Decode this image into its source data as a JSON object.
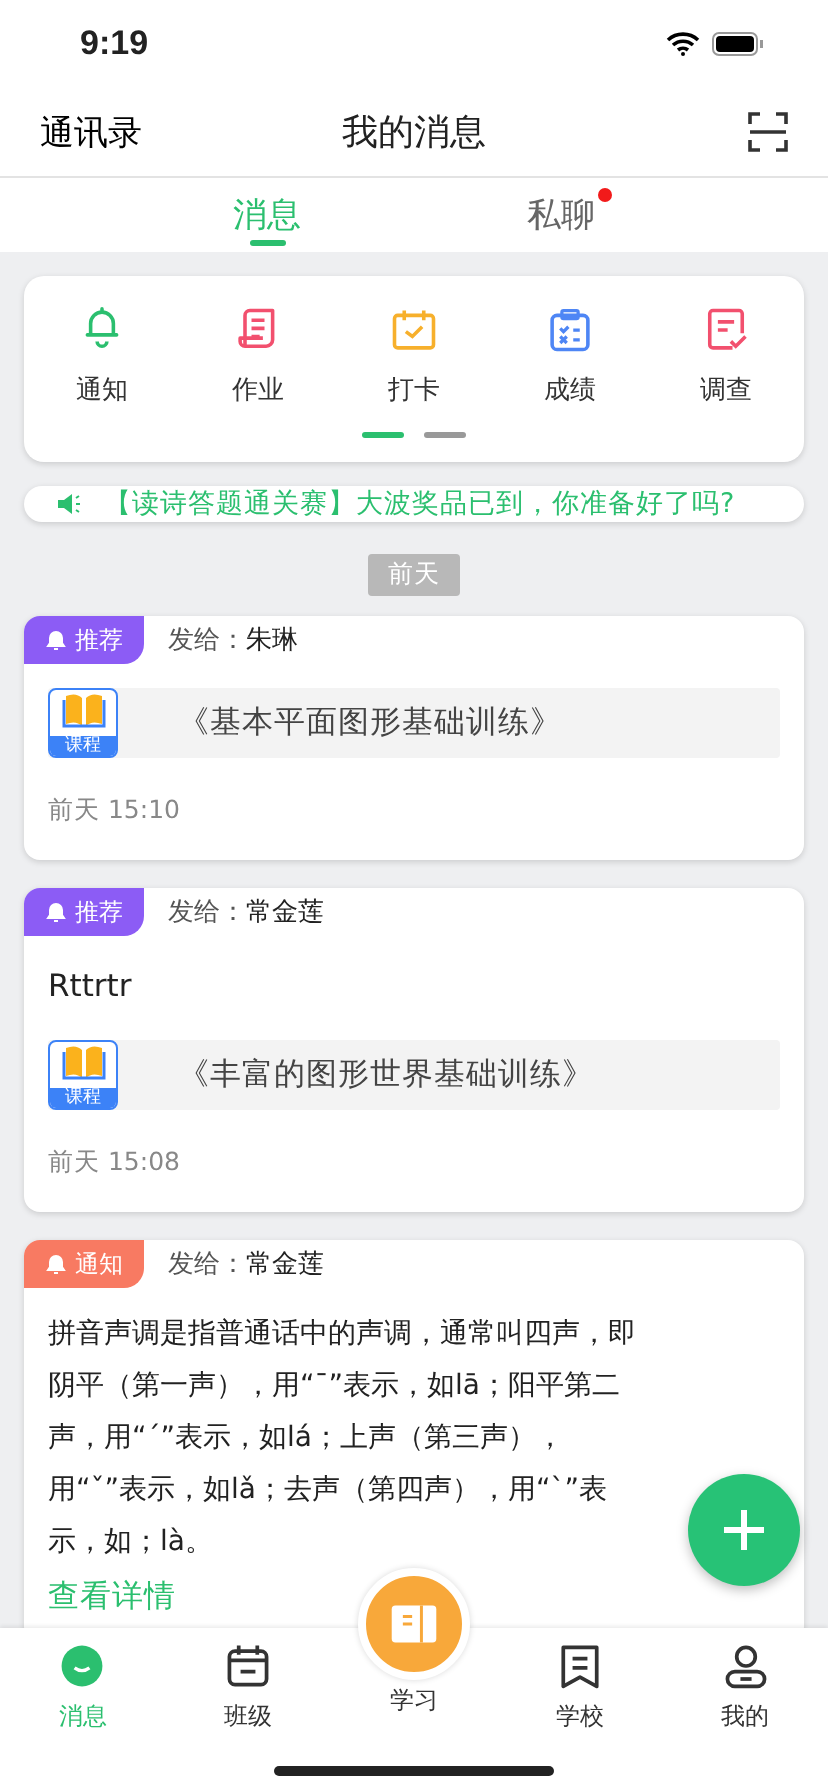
{
  "status_bar": {
    "time": "9:19"
  },
  "header": {
    "left": "通讯录",
    "title": "我的消息"
  },
  "tabs": [
    {
      "label": "消息",
      "selected": true,
      "unread": false
    },
    {
      "label": "私聊",
      "selected": false,
      "unread": true
    }
  ],
  "categories": [
    {
      "label": "通知",
      "kind": "bell",
      "color": "#2bbf6f"
    },
    {
      "label": "作业",
      "kind": "homework",
      "color": "#f2506e"
    },
    {
      "label": "打卡",
      "kind": "calendar",
      "color": "#f7b02c"
    },
    {
      "label": "成绩",
      "kind": "clipboard",
      "color": "#4e86f5"
    },
    {
      "label": "调查",
      "kind": "survey",
      "color": "#f2506e"
    }
  ],
  "pages": [
    {
      "selected": true
    },
    {
      "selected": false
    }
  ],
  "notice": {
    "text": "【读诗答题通关赛】大波奖品已到，你准备好了吗?"
  },
  "date_chip": "前天",
  "messages": [
    {
      "tag": "推荐",
      "color": "#8c5cf5",
      "to_label": "发给：",
      "to": "朱琳",
      "course": {
        "badge": "课程",
        "title": "《基本平面图形基础训练》"
      },
      "time": "前天 15:10"
    },
    {
      "tag": "推荐",
      "color": "#8c5cf5",
      "to_label": "发给：",
      "to": "常金莲",
      "body": "Rttrtr",
      "course": {
        "badge": "课程",
        "title": "《丰富的图形世界基础训练》"
      },
      "time": "前天 15:08"
    },
    {
      "tag": "通知",
      "color": "#f87a62",
      "to_label": "发给：",
      "to": "常金莲",
      "body": "拼音声调是指普通话中的声调，通常叫四声，即阴平（第一声），用“ˉ”表示，如lā；阳平第二声，用“ˊ”表示，如lá；上声（第三声），用“ˇ”表示，如lǎ；去声（第四声），用“ˋ”表示，如；là。",
      "link": "查看详情"
    }
  ],
  "nav": [
    {
      "label": "消息",
      "kind": "chat",
      "selected": true
    },
    {
      "label": "班级",
      "kind": "class",
      "selected": false
    },
    {
      "label": "学习",
      "kind": "center",
      "selected": false
    },
    {
      "label": "学校",
      "kind": "school",
      "selected": false
    },
    {
      "label": "我的",
      "kind": "me",
      "selected": false
    }
  ]
}
